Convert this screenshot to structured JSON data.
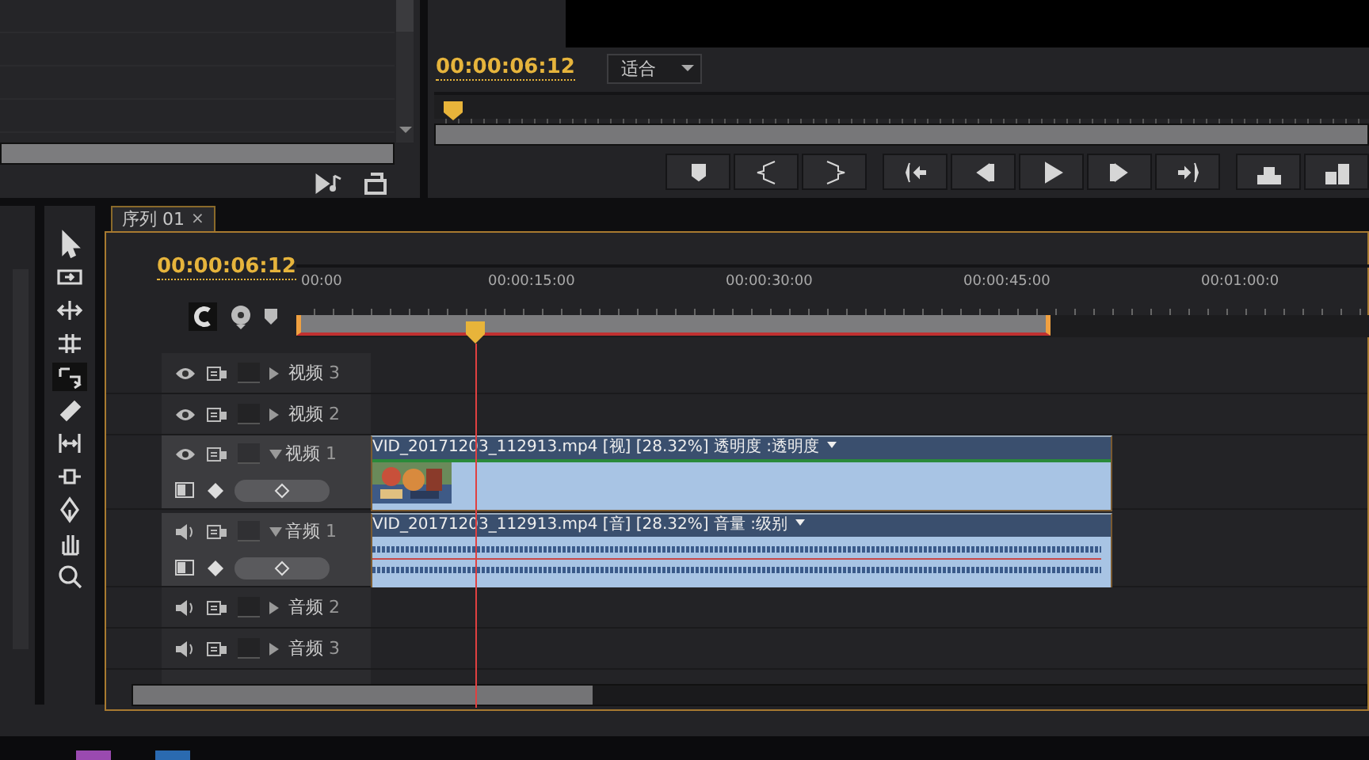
{
  "monitor": {
    "timecode": "00:00:06:12",
    "zoom_menu": "适合"
  },
  "tools": [
    {
      "kind": "select",
      "selected": false
    },
    {
      "kind": "track-select",
      "selected": false
    },
    {
      "kind": "ripple",
      "selected": false
    },
    {
      "kind": "rolling",
      "selected": false
    },
    {
      "kind": "rate-stretch",
      "selected": true
    },
    {
      "kind": "razor",
      "selected": false
    },
    {
      "kind": "slip",
      "selected": false
    },
    {
      "kind": "slide",
      "selected": false
    },
    {
      "kind": "pen",
      "selected": false
    },
    {
      "kind": "hand",
      "selected": false
    },
    {
      "kind": "zoom",
      "selected": false
    }
  ],
  "sequence_tab": {
    "label": "序列",
    "number": "01",
    "close": "×",
    "selected": true
  },
  "timeline": {
    "timecode": "00:00:06:12",
    "ruler_labels": [
      "00:00",
      "00:00:15:00",
      "00:00:30:00",
      "00:00:45:00",
      "00:01:00:0"
    ],
    "video_tracks": [
      {
        "name": "视频",
        "number": "3",
        "expanded": false
      },
      {
        "name": "视频",
        "number": "2",
        "expanded": false
      },
      {
        "name": "视频",
        "number": "1",
        "expanded": true,
        "clip": {
          "file": "VID_20171203_112913.mp4",
          "type_tag": "[视]",
          "speed": "[28.32%]",
          "effect": "透明度 :透明度"
        }
      }
    ],
    "audio_tracks": [
      {
        "name": "音频",
        "number": "1",
        "expanded": true,
        "clip": {
          "file": "VID_20171203_112913.mp4",
          "type_tag": "[音]",
          "speed": "[28.32%]",
          "effect": "音量 :级别"
        }
      },
      {
        "name": "音频",
        "number": "2",
        "expanded": false
      },
      {
        "name": "音频",
        "number": "3",
        "expanded": false
      }
    ]
  }
}
